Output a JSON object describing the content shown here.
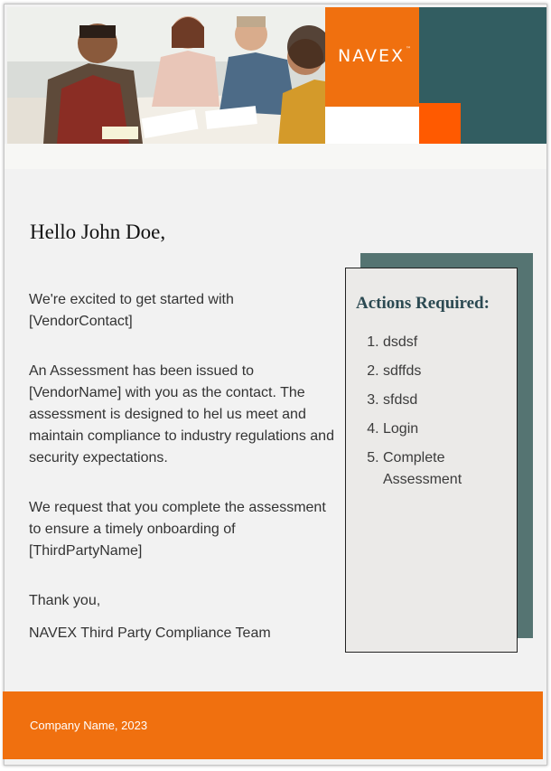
{
  "brand": {
    "logo_text": "NAVEX",
    "accent_orange": "#f0700f",
    "accent_teal": "#325d61"
  },
  "greeting": "Hello John Doe,",
  "body": {
    "p1": "We're excited to get started with [VendorContact]",
    "p2": "An Assessment has been issued to [VendorName] with you as the contact. The assessment is designed to hel us meet and maintain compliance to industry regulations and security expectations.",
    "p3": "We request that you complete the assessment to ensure a timely onboarding of [ThirdPartyName]",
    "p4": "Thank you,",
    "p5": "NAVEX Third Party Compliance Team"
  },
  "actions": {
    "title": "Actions Required:",
    "items": [
      "dsdsf",
      "sdffds",
      "sfdsd",
      "Login",
      "Complete Assessment"
    ]
  },
  "footer": {
    "text": "Company Name, 2023"
  }
}
